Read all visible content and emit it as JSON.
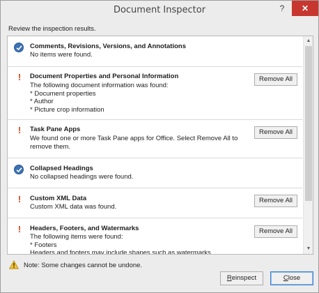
{
  "window": {
    "title": "Document Inspector",
    "help_glyph": "?",
    "close_glyph": "✕"
  },
  "subtitle": "Review the inspection results.",
  "results": [
    {
      "status": "ok",
      "title": "Comments, Revisions, Versions, and Annotations",
      "description": "No items were found.",
      "button": null
    },
    {
      "status": "warning",
      "title": "Document Properties and Personal Information",
      "description": "The following document information was found:\n* Document properties\n* Author\n* Picture crop information",
      "button": "Remove All"
    },
    {
      "status": "warning",
      "title": "Task Pane Apps",
      "description": "We found one or more Task Pane apps for Office. Select Remove All to remove them.",
      "button": "Remove All"
    },
    {
      "status": "ok",
      "title": "Collapsed Headings",
      "description": "No collapsed headings were found.",
      "button": null
    },
    {
      "status": "warning",
      "title": "Custom XML Data",
      "description": "Custom XML data was found.",
      "button": "Remove All"
    },
    {
      "status": "warning",
      "title": "Headers, Footers, and Watermarks",
      "description": "The following items were found:\n* Footers\nHeaders and footers may include shapes such as watermarks.",
      "button": "Remove All"
    }
  ],
  "footer": {
    "note": "Note: Some changes cannot be undone.",
    "reinspect_label": "Reinspect",
    "reinspect_accel": "R",
    "reinspect_rest": "einspect",
    "close_label": "Close",
    "close_accel": "C",
    "close_rest": "lose"
  },
  "colors": {
    "ok_icon": "#3c72b2",
    "warning_icon": "#d04a1a",
    "close_button": "#c7372f"
  },
  "icons": {
    "ok": "checkmark-circle-icon",
    "warning": "exclamation-icon",
    "footer_warning": "warning-triangle-icon"
  }
}
